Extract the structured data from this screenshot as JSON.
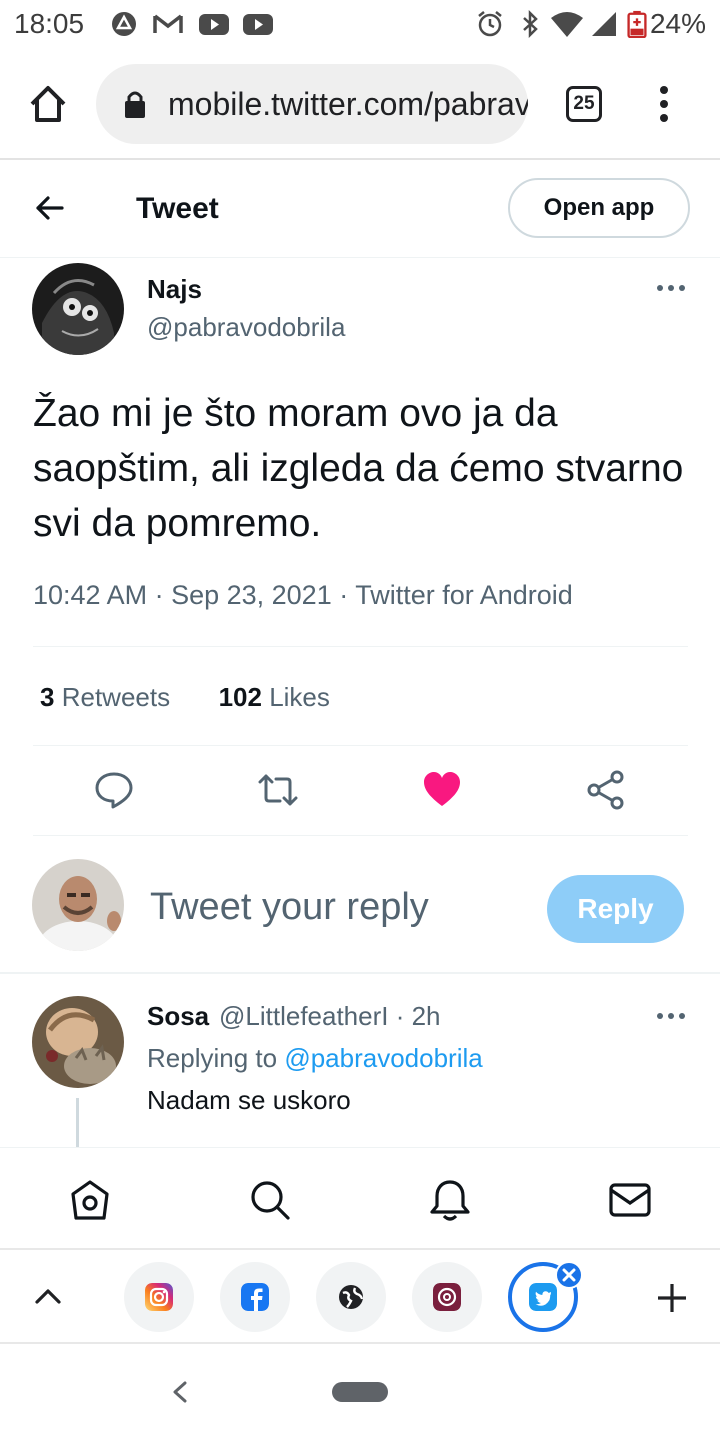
{
  "status_bar": {
    "time": "18:05",
    "battery": "24%",
    "icons": [
      "drive-icon",
      "gmail-icon",
      "youtube-icon",
      "youtube-icon",
      "alarm-icon",
      "bluetooth-icon",
      "wifi-icon",
      "signal-icon",
      "battery-icon"
    ]
  },
  "browser": {
    "url": "mobile.twitter.com/pabravodobrila",
    "tab_count": "25"
  },
  "header": {
    "title": "Tweet",
    "open_app_label": "Open app"
  },
  "tweet": {
    "author_name": "Najs",
    "author_handle": "@pabravodobrila",
    "text": "Žao mi je što moram ovo ja da saopštim, ali izgleda da ćemo stvarno svi da pomremo.",
    "meta": "10:42 AM · Sep 23, 2021 · Twitter for Android",
    "retweets_count": "3",
    "retweets_label": "Retweets",
    "likes_count": "102",
    "likes_label": "Likes",
    "liked": true
  },
  "compose": {
    "placeholder": "Tweet your reply",
    "reply_label": "Reply"
  },
  "reply": {
    "author_name": "Sosa",
    "author_handle_time": "@LittlefeatherI · 2h",
    "replying_prefix": "Replying to",
    "replying_to": "@pabravodobrila",
    "text": "Nadam se uskoro"
  },
  "colors": {
    "accent": "#1d9bf0",
    "like": "#f91880",
    "reply_button": "#8ecdf8",
    "secondary_text": "#536471"
  },
  "bottom_nav": [
    "home-icon",
    "search-icon",
    "notifications-icon",
    "messages-icon"
  ],
  "tab_strip": [
    "instagram-icon",
    "facebook-icon",
    "globe-icon",
    "threads-icon",
    "twitter-icon"
  ]
}
